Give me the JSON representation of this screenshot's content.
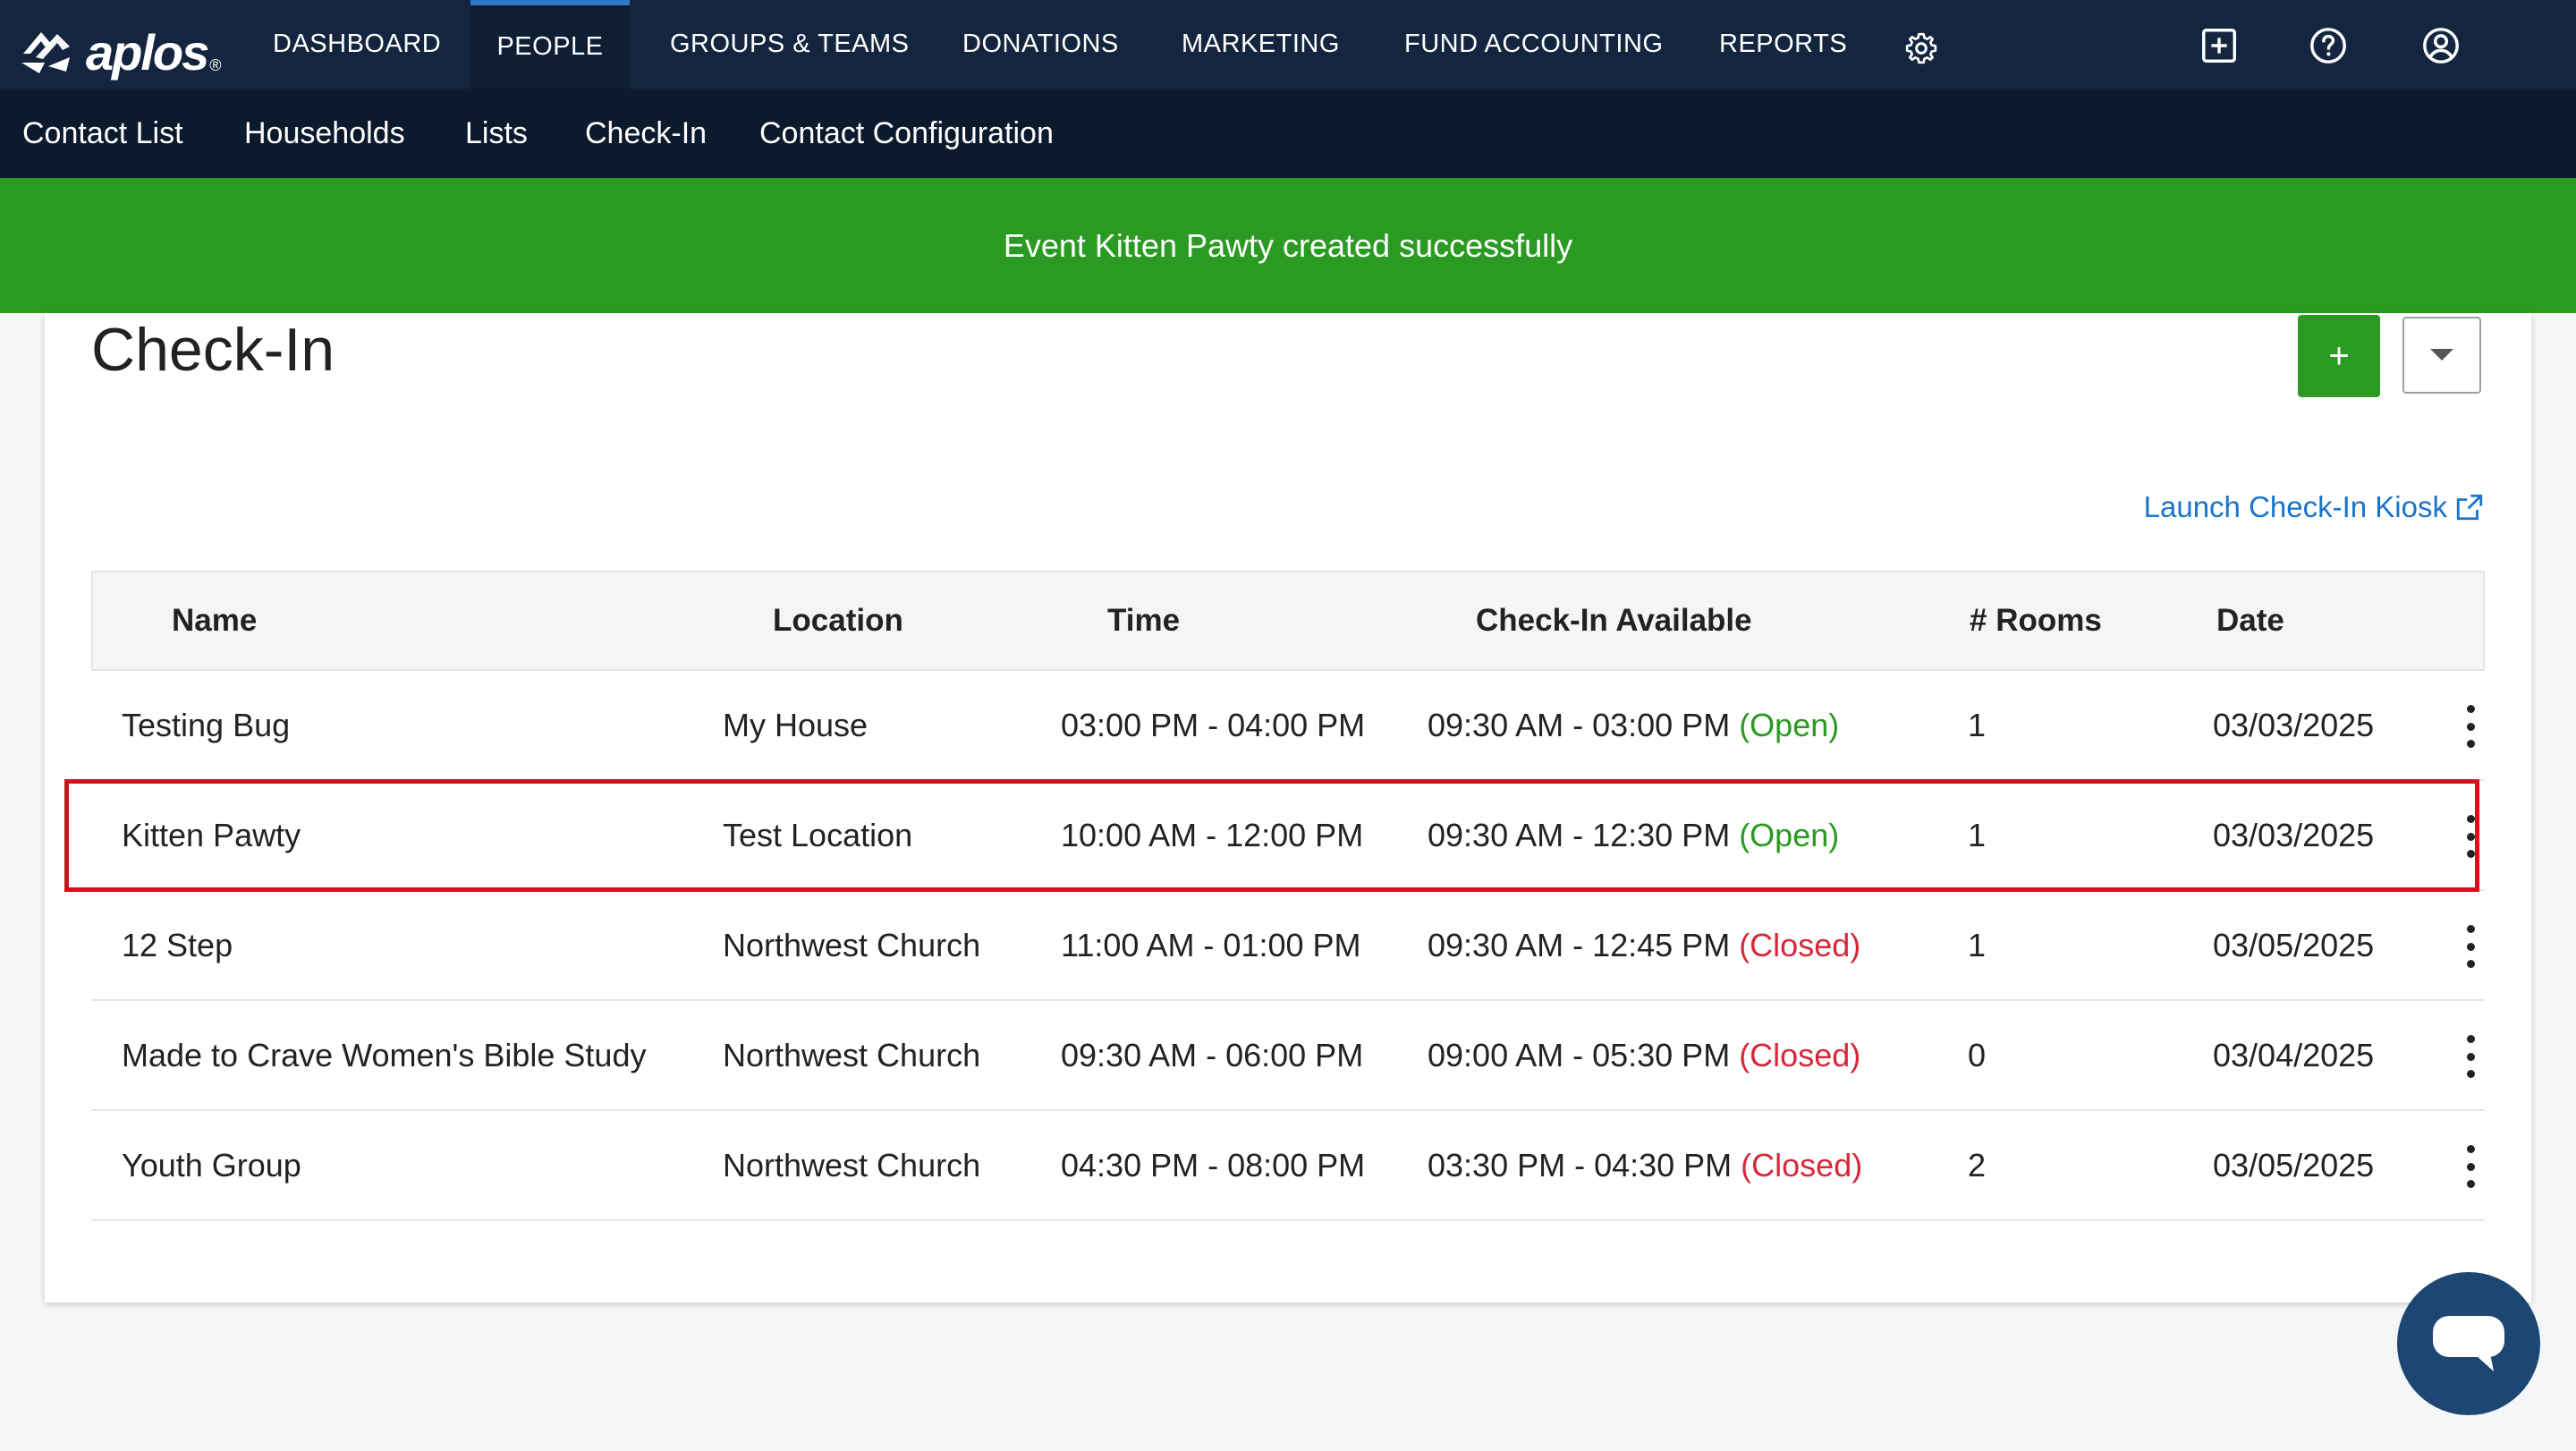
{
  "logo": {
    "text": "aplos",
    "reg": "®"
  },
  "nav": {
    "items": [
      {
        "label": "DASHBOARD"
      },
      {
        "label": "PEOPLE"
      },
      {
        "label": "GROUPS & TEAMS"
      },
      {
        "label": "DONATIONS"
      },
      {
        "label": "MARKETING"
      },
      {
        "label": "FUND ACCOUNTING"
      },
      {
        "label": "REPORTS"
      }
    ],
    "icons": [
      "gear-icon",
      "add-box-icon",
      "help-icon",
      "account-icon"
    ]
  },
  "subnav": {
    "items": [
      {
        "label": "Contact List"
      },
      {
        "label": "Households"
      },
      {
        "label": "Lists"
      },
      {
        "label": "Check-In"
      },
      {
        "label": "Contact Configuration"
      }
    ]
  },
  "banner": {
    "message": "Event Kitten Pawty created successfully"
  },
  "page": {
    "title": "Check-In",
    "add_label": "+",
    "launch_label": "Launch Check-In Kiosk"
  },
  "table": {
    "headers": {
      "name": "Name",
      "location": "Location",
      "time": "Time",
      "available": "Check-In Available",
      "rooms": "# Rooms",
      "date": "Date"
    },
    "rows": [
      {
        "name": "Testing Bug",
        "location": "My House",
        "time": "03:00 PM - 04:00 PM",
        "available": "09:30 AM - 03:00 PM",
        "status": "(Open)",
        "rooms": "1",
        "date": "03/03/2025"
      },
      {
        "name": "Kitten Pawty",
        "location": "Test Location",
        "time": "10:00 AM - 12:00 PM",
        "available": "09:30 AM - 12:30 PM",
        "status": "(Open)",
        "rooms": "1",
        "date": "03/03/2025"
      },
      {
        "name": "12 Step",
        "location": "Northwest Church",
        "time": "11:00 AM - 01:00 PM",
        "available": "09:30 AM - 12:45 PM",
        "status": "(Closed)",
        "rooms": "1",
        "date": "03/05/2025"
      },
      {
        "name": "Made to Crave Women's Bible Study",
        "location": "Northwest Church",
        "time": "09:30 AM - 06:00 PM",
        "available": "09:00 AM - 05:30 PM",
        "status": "(Closed)",
        "rooms": "0",
        "date": "03/04/2025"
      },
      {
        "name": "Youth Group",
        "location": "Northwest Church",
        "time": "04:30 PM - 08:00 PM",
        "available": "03:30 PM - 04:30 PM",
        "status": "(Closed)",
        "rooms": "2",
        "date": "03/05/2025"
      }
    ]
  },
  "colors": {
    "nav_bg": "#14263f",
    "subnav_bg": "#0c1a2e",
    "success": "#2a9a23",
    "open": "#2a9a23",
    "closed": "#d62839",
    "link": "#1a74c9",
    "highlight": "#d0121b"
  }
}
